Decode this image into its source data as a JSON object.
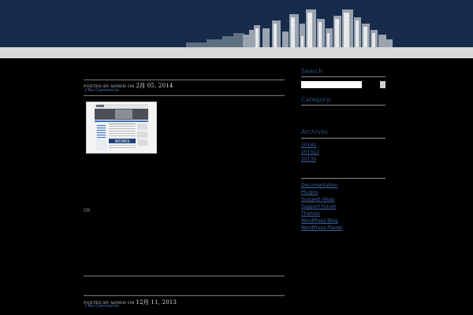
{
  "sidebar": {
    "search_heading": "Search",
    "category_heading": "Category:",
    "archives_heading": "Archives",
    "archives": [
      "20142",
      "201312",
      "20135"
    ],
    "links": [
      "Documentation",
      "Plugins",
      "Suggest Ideas",
      "Support Forum",
      "Themes",
      "WordPress Blog",
      "WordPress Planet"
    ]
  },
  "posts": [
    {
      "posted_prefix": "POSTED BY ADMIN ON",
      "date": "2月 05, 2014",
      "comments_prefix": "/",
      "comments_label": "No Comments",
      "body_text": "OK",
      "body_dot": "."
    },
    {
      "posted_prefix": "POSTED BY ADMIN ON",
      "date": "12月 11, 2013",
      "comments_prefix": "/",
      "comments_label": "No Comments"
    }
  ],
  "thumbnail": {
    "banner_text": "WORKS"
  },
  "colors": {
    "header_bg": "#172b4a",
    "nav_bar": "#d8d9da",
    "page_bg": "#000000",
    "link": "#3f66a8",
    "heading": "#2e4d7c"
  },
  "icons": {
    "header_art": "city-skyline-icon"
  }
}
